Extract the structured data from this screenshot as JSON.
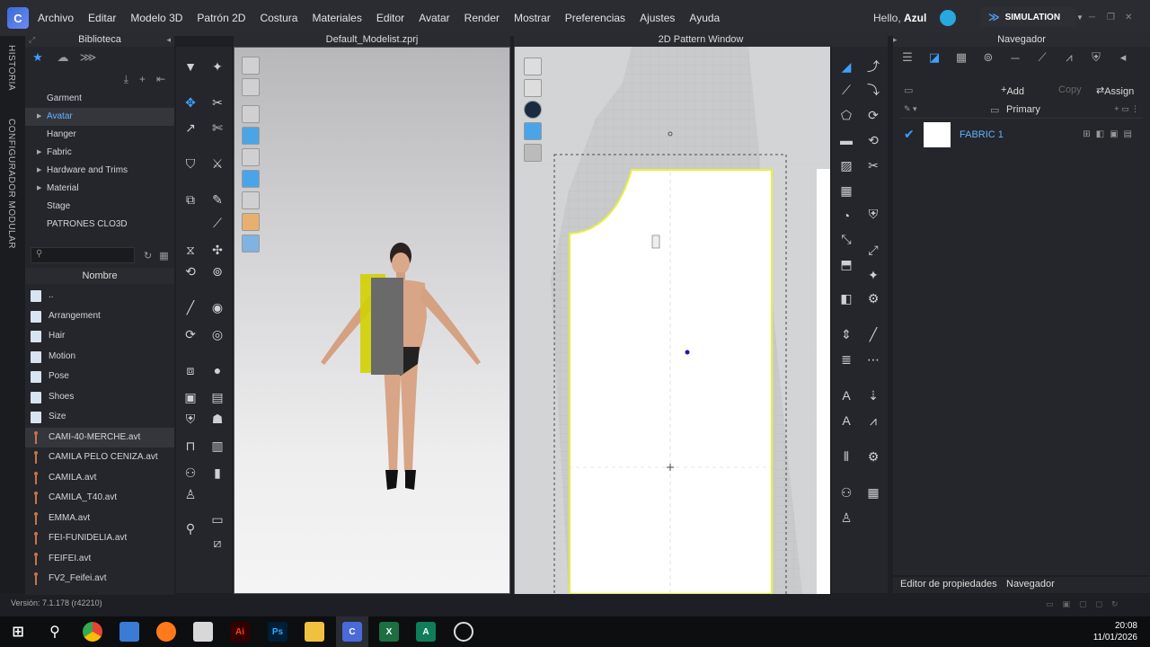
{
  "menu": {
    "items": [
      "Archivo",
      "Editar",
      "Modelo 3D",
      "Patrón 2D",
      "Costura",
      "Materiales",
      "Editor",
      "Avatar",
      "Render",
      "Mostrar",
      "Preferencias",
      "Ajustes",
      "Ayuda"
    ],
    "greeting": "Hello, ",
    "user": "Azul",
    "mode_button": "SIMULATION"
  },
  "side_tabs": {
    "history": "HISTORIA",
    "configurator": "CONFIGURADOR MODULAR"
  },
  "library": {
    "title": "Biblioteca",
    "tree": [
      {
        "label": "Garment",
        "expandable": false
      },
      {
        "label": "Avatar",
        "expandable": true,
        "selected": true
      },
      {
        "label": "Hanger",
        "expandable": false
      },
      {
        "label": "Fabric",
        "expandable": true
      },
      {
        "label": "Hardware and Trims",
        "expandable": true
      },
      {
        "label": "Material",
        "expandable": true
      },
      {
        "label": "Stage",
        "expandable": false
      },
      {
        "label": "PATRONES CLO3D",
        "expandable": false
      }
    ],
    "column_header": "Nombre",
    "files": [
      {
        "name": "..",
        "kind": "folder"
      },
      {
        "name": "Arrangement",
        "kind": "folder"
      },
      {
        "name": "Hair",
        "kind": "folder"
      },
      {
        "name": "Motion",
        "kind": "folder"
      },
      {
        "name": "Pose",
        "kind": "folder"
      },
      {
        "name": "Shoes",
        "kind": "folder"
      },
      {
        "name": "Size",
        "kind": "folder"
      },
      {
        "name": "CAMI-40-MERCHE.avt",
        "kind": "avatar",
        "selected": true
      },
      {
        "name": "CAMILA PELO CENIZA.avt",
        "kind": "avatar"
      },
      {
        "name": "CAMILA.avt",
        "kind": "avatar"
      },
      {
        "name": "CAMILA_T40.avt",
        "kind": "avatar"
      },
      {
        "name": "EMMA.avt",
        "kind": "avatar"
      },
      {
        "name": "FEI-FUNIDELIA.avt",
        "kind": "avatar"
      },
      {
        "name": "FEIFEI.avt",
        "kind": "avatar"
      },
      {
        "name": "FV2_Feifei.avt",
        "kind": "avatar"
      }
    ]
  },
  "window_3d": {
    "title": "Default_Modelist.zprj"
  },
  "window_2d": {
    "title": "2D Pattern Window"
  },
  "navigator": {
    "title": "Navegador",
    "add_label": "Add",
    "copy_label": "Copy",
    "assign_label": "Assign",
    "group_label": "Primary",
    "fabrics": [
      {
        "name": "FABRIC 1",
        "swatch": "#ffffff"
      }
    ]
  },
  "bottom_tabs": {
    "properties": "Editor de propiedades",
    "navigator": "Navegador"
  },
  "status": {
    "version": "Versión: 7.1.178 (r42210)"
  },
  "taskbar": {
    "time": "20:08",
    "date": "11/01/2026"
  },
  "colors": {
    "accent": "#3da0ff",
    "pattern_outline": "#e8f03c",
    "panel": "#25262b"
  }
}
